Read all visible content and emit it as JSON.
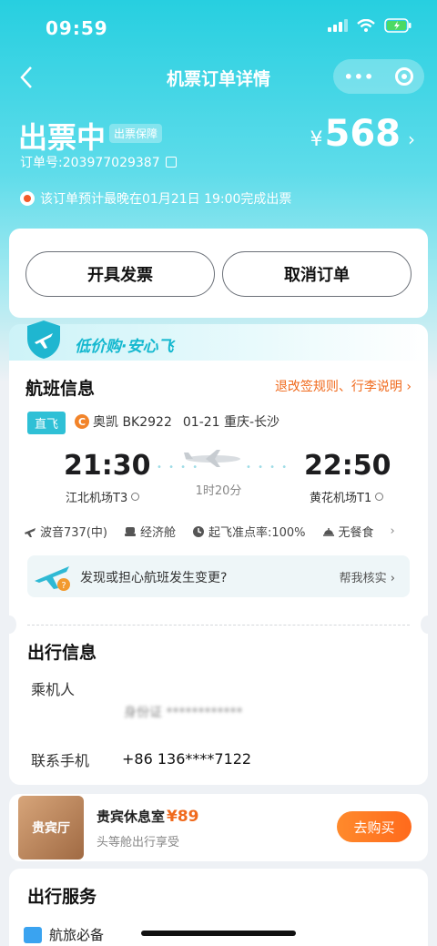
{
  "status_bar": {
    "time": "09:59"
  },
  "nav": {
    "title": "机票订单详情",
    "more_dots": "•••"
  },
  "header": {
    "status": "出票中",
    "guarantee_badge": "出票保障",
    "currency": "¥",
    "price": "568",
    "order_no": "订单号:203977029387",
    "notice": "该订单预计最晚在01月21日 19:00完成出票"
  },
  "actions": {
    "invoice": "开具发票",
    "cancel": "取消订单"
  },
  "promo": {
    "text": "低价购·安心飞"
  },
  "flight": {
    "section_title": "航班信息",
    "rules_link": "退改签规则、行李说明",
    "direct_tag": "直飞",
    "airline": "奥凯 BK2922",
    "date_route": "01-21 重庆-长沙",
    "dep_time": "21:30",
    "arr_time": "22:50",
    "dep_airport": "江北机场T3",
    "arr_airport": "黄花机场T1",
    "duration": "1时20分",
    "aircraft": "波音737(中)",
    "cabin": "经济舱",
    "ontime": "起飞准点率:100%",
    "meal": "无餐食",
    "check_text": "发现或担心航班发生变更?",
    "check_link": "帮我核实"
  },
  "travel": {
    "section_title": "出行信息",
    "passenger_label": "乘机人",
    "id_masked": "身份证 ************",
    "phone_label": "联系手机",
    "phone": "+86 136****7122"
  },
  "lounge": {
    "img_label": "贵宾厅",
    "title": "贵宾休息室",
    "price": "¥89",
    "subtitle": "头等舱出行享受",
    "buy": "去购买"
  },
  "services": {
    "section_title": "出行服务",
    "item": "航旅必备"
  },
  "colors": {
    "accent": "#2fc0d6",
    "orange": "#f06a1d"
  }
}
